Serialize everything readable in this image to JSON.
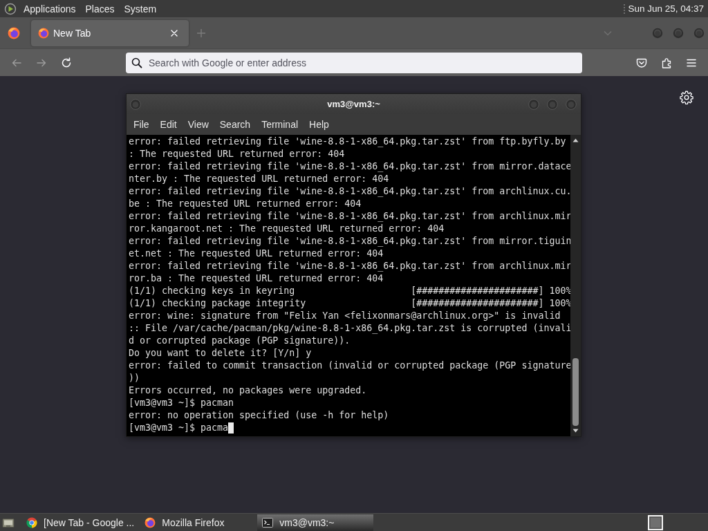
{
  "top_panel": {
    "menus": [
      "Applications",
      "Places",
      "System"
    ],
    "clock": "Sun Jun 25, 04:37"
  },
  "browser": {
    "tabs": [
      {
        "label": "New Tab",
        "selected": true
      }
    ],
    "nav_buttons": [
      {
        "disabled": true
      },
      {
        "disabled": true
      },
      {
        "disabled": false
      }
    ],
    "address_bar": {
      "placeholder": "Search with Google or enter address"
    }
  },
  "terminal": {
    "title": "vm3@vm3:~",
    "menus": [
      "File",
      "Edit",
      "View",
      "Search",
      "Terminal",
      "Help"
    ],
    "lines": [
      "error: failed retrieving file 'wine-8.8-1-x86_64.pkg.tar.zst' from ftp.byfly.by",
      ": The requested URL returned error: 404",
      "error: failed retrieving file 'wine-8.8-1-x86_64.pkg.tar.zst' from mirror.datace",
      "nter.by : The requested URL returned error: 404",
      "error: failed retrieving file 'wine-8.8-1-x86_64.pkg.tar.zst' from archlinux.cu.",
      "be : The requested URL returned error: 404",
      "error: failed retrieving file 'wine-8.8-1-x86_64.pkg.tar.zst' from archlinux.mir",
      "ror.kangaroot.net : The requested URL returned error: 404",
      "error: failed retrieving file 'wine-8.8-1-x86_64.pkg.tar.zst' from mirror.tiguin",
      "et.net : The requested URL returned error: 404",
      "error: failed retrieving file 'wine-8.8-1-x86_64.pkg.tar.zst' from archlinux.mir",
      "ror.ba : The requested URL returned error: 404",
      "(1/1) checking keys in keyring                     [######################] 100%",
      "(1/1) checking package integrity                   [######################] 100%",
      "error: wine: signature from \"Felix Yan <felixonmars@archlinux.org>\" is invalid",
      ":: File /var/cache/pacman/pkg/wine-8.8-1-x86_64.pkg.tar.zst is corrupted (invali",
      "d or corrupted package (PGP signature)).",
      "Do you want to delete it? [Y/n] y",
      "error: failed to commit transaction (invalid or corrupted package (PGP signature",
      "))",
      "Errors occurred, no packages were upgraded.",
      "[vm3@vm3 ~]$ pacman",
      "error: no operation specified (use -h for help)",
      "[vm3@vm3 ~]$ pacma"
    ]
  },
  "taskbar": {
    "tasks": [
      {
        "label": "[New Tab - Google ...",
        "selected": false
      },
      {
        "label": "Mozilla Firefox",
        "selected": false
      },
      {
        "label": "vm3@vm3:~",
        "selected": true
      }
    ]
  }
}
